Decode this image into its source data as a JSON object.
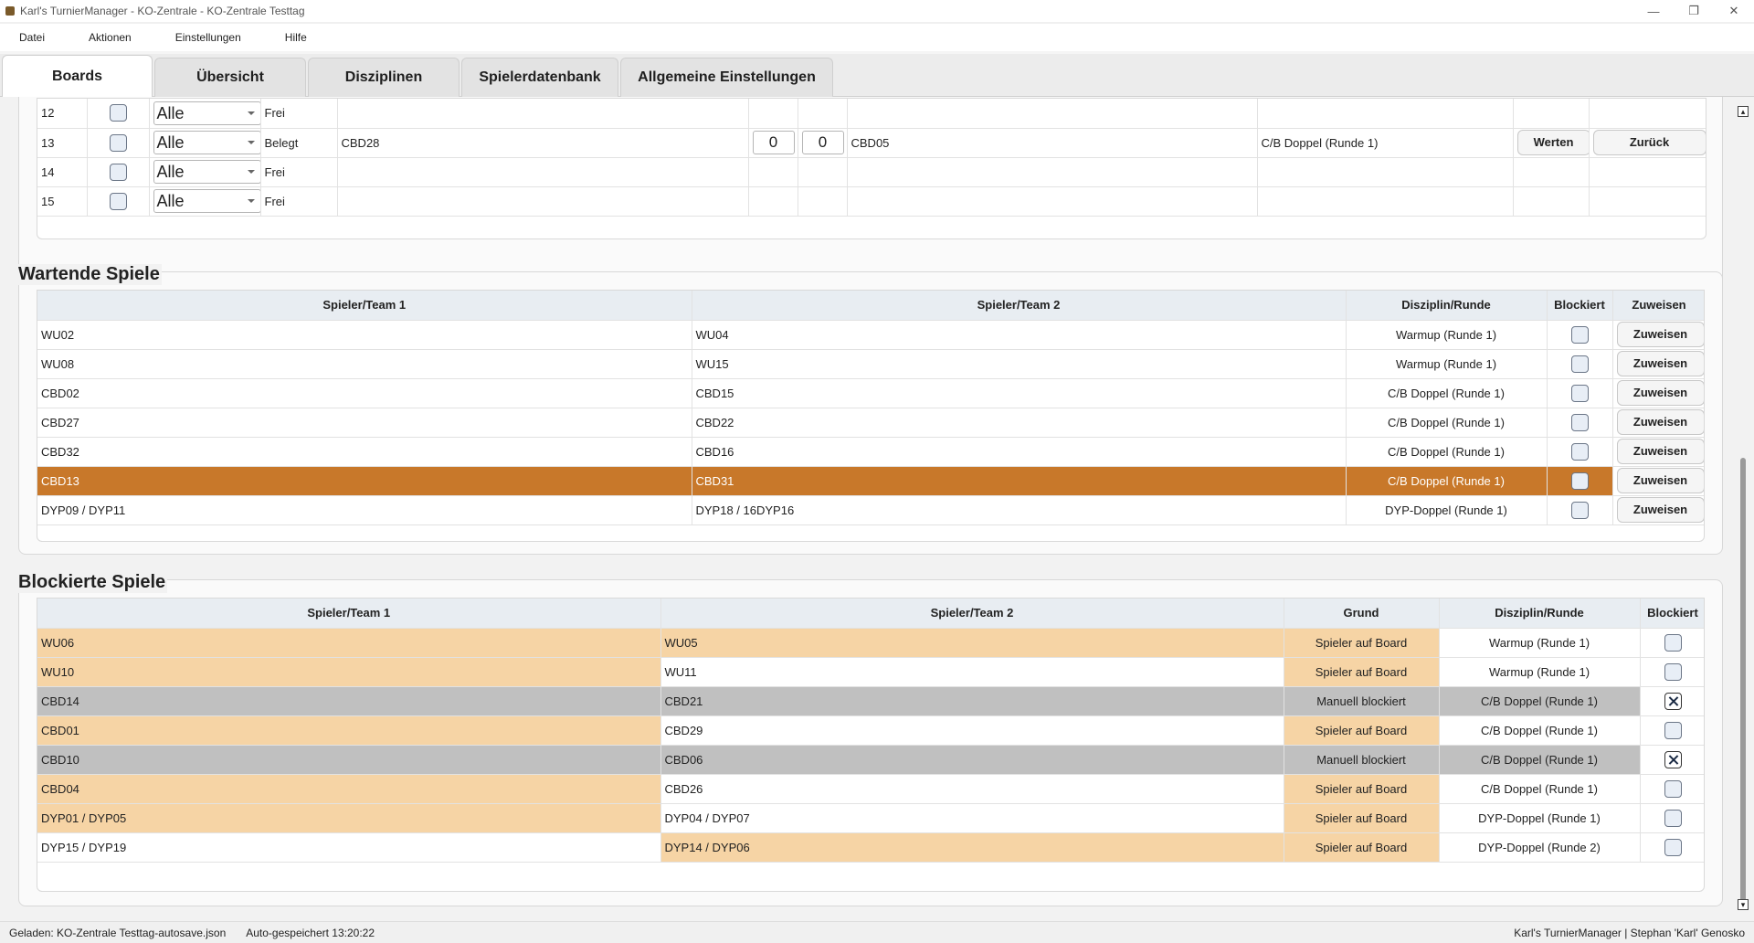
{
  "window": {
    "title": "Karl's TurnierManager - KO-Zentrale - KO-Zentrale Testtag",
    "minimize": "—",
    "maximize": "❐",
    "close": "✕"
  },
  "menu": [
    "Datei",
    "Aktionen",
    "Einstellungen",
    "Hilfe"
  ],
  "tabs": [
    "Boards",
    "Übersicht",
    "Disziplinen",
    "Spielerdatenbank",
    "Allgemeine Einstellungen"
  ],
  "active_tab": "Boards",
  "boards": [
    {
      "nr": "12",
      "filter": "Alle",
      "status": "Frei",
      "team1": "",
      "score1": "",
      "score2": "",
      "team2": "",
      "disziplin": "",
      "btn_werten": "",
      "btn_zurueck": ""
    },
    {
      "nr": "13",
      "filter": "Alle",
      "status": "Belegt",
      "team1": "CBD28",
      "score1": "0",
      "score2": "0",
      "team2": "CBD05",
      "disziplin": "C/B Doppel (Runde 1)",
      "btn_werten": "Werten",
      "btn_zurueck": "Zurück"
    },
    {
      "nr": "14",
      "filter": "Alle",
      "status": "Frei",
      "team1": "",
      "score1": "",
      "score2": "",
      "team2": "",
      "disziplin": "",
      "btn_werten": "",
      "btn_zurueck": ""
    },
    {
      "nr": "15",
      "filter": "Alle",
      "status": "Frei",
      "team1": "",
      "score1": "",
      "score2": "",
      "team2": "",
      "disziplin": "",
      "btn_werten": "",
      "btn_zurueck": ""
    }
  ],
  "waiting": {
    "title": "Wartende Spiele",
    "headers": [
      "Spieler/Team 1",
      "Spieler/Team 2",
      "Disziplin/Runde",
      "Blockiert",
      "Zuweisen"
    ],
    "rows": [
      {
        "t1": "WU02",
        "t2": "WU04",
        "dr": "Warmup (Runde 1)",
        "blocked": false,
        "btn": "Zuweisen",
        "selected": false
      },
      {
        "t1": "WU08",
        "t2": "WU15",
        "dr": "Warmup (Runde 1)",
        "blocked": false,
        "btn": "Zuweisen",
        "selected": false
      },
      {
        "t1": "CBD02",
        "t2": "CBD15",
        "dr": "C/B Doppel (Runde 1)",
        "blocked": false,
        "btn": "Zuweisen",
        "selected": false
      },
      {
        "t1": "CBD27",
        "t2": "CBD22",
        "dr": "C/B Doppel (Runde 1)",
        "blocked": false,
        "btn": "Zuweisen",
        "selected": false
      },
      {
        "t1": "CBD32",
        "t2": "CBD16",
        "dr": "C/B Doppel (Runde 1)",
        "blocked": false,
        "btn": "Zuweisen",
        "selected": false
      },
      {
        "t1": "CBD13",
        "t2": "CBD31",
        "dr": "C/B Doppel (Runde 1)",
        "blocked": false,
        "btn": "Zuweisen",
        "selected": true
      },
      {
        "t1": "DYP09 / DYP11",
        "t2": "DYP18 / 16DYP16",
        "dr": "DYP-Doppel (Runde 1)",
        "blocked": false,
        "btn": "Zuweisen",
        "selected": false
      }
    ]
  },
  "blocked": {
    "title": "Blockierte Spiele",
    "headers": [
      "Spieler/Team 1",
      "Spieler/Team 2",
      "Grund",
      "Disziplin/Runde",
      "Blockiert"
    ],
    "rows": [
      {
        "t1": "WU06",
        "t2": "WU05",
        "grund": "Spieler auf Board",
        "dr": "Warmup (Runde 1)",
        "blocked": false,
        "hl": [
          "orange",
          "orange",
          "orange",
          "",
          ""
        ]
      },
      {
        "t1": "WU10",
        "t2": "WU11",
        "grund": "Spieler auf Board",
        "dr": "Warmup (Runde 1)",
        "blocked": false,
        "hl": [
          "orange",
          "",
          "orange",
          "",
          ""
        ]
      },
      {
        "t1": "CBD14",
        "t2": "CBD21",
        "grund": "Manuell blockiert",
        "dr": "C/B Doppel (Runde 1)",
        "blocked": true,
        "hl": [
          "gray",
          "gray",
          "gray",
          "gray",
          ""
        ]
      },
      {
        "t1": "CBD01",
        "t2": "CBD29",
        "grund": "Spieler auf Board",
        "dr": "C/B Doppel (Runde 1)",
        "blocked": false,
        "hl": [
          "orange",
          "",
          "orange",
          "",
          ""
        ]
      },
      {
        "t1": "CBD10",
        "t2": "CBD06",
        "grund": "Manuell blockiert",
        "dr": "C/B Doppel (Runde 1)",
        "blocked": true,
        "hl": [
          "gray",
          "gray",
          "gray",
          "gray",
          ""
        ]
      },
      {
        "t1": "CBD04",
        "t2": "CBD26",
        "grund": "Spieler auf Board",
        "dr": "C/B Doppel (Runde 1)",
        "blocked": false,
        "hl": [
          "orange",
          "",
          "orange",
          "",
          ""
        ]
      },
      {
        "t1": "DYP01 / DYP05",
        "t2": "DYP04 / DYP07",
        "grund": "Spieler auf Board",
        "dr": "DYP-Doppel (Runde 1)",
        "blocked": false,
        "hl": [
          "orange",
          "",
          "orange",
          "",
          ""
        ]
      },
      {
        "t1": "DYP15 / DYP19",
        "t2": "DYP14 / DYP06",
        "grund": "Spieler auf Board",
        "dr": "DYP-Doppel (Runde 2)",
        "blocked": false,
        "hl": [
          "",
          "orange",
          "orange",
          "",
          ""
        ]
      }
    ]
  },
  "status": {
    "loaded": "Geladen: KO-Zentrale Testtag-autosave.json",
    "autosave": "Auto-gespeichert 13:20:22",
    "credit": "Karl's TurnierManager | Stephan 'Karl' Genosko"
  },
  "colors": {
    "selected_row": "#c8782a",
    "player_on_board": "#f6d4a5",
    "manually_blocked": "#c0c0c0",
    "header_bg": "#e8edf2"
  }
}
